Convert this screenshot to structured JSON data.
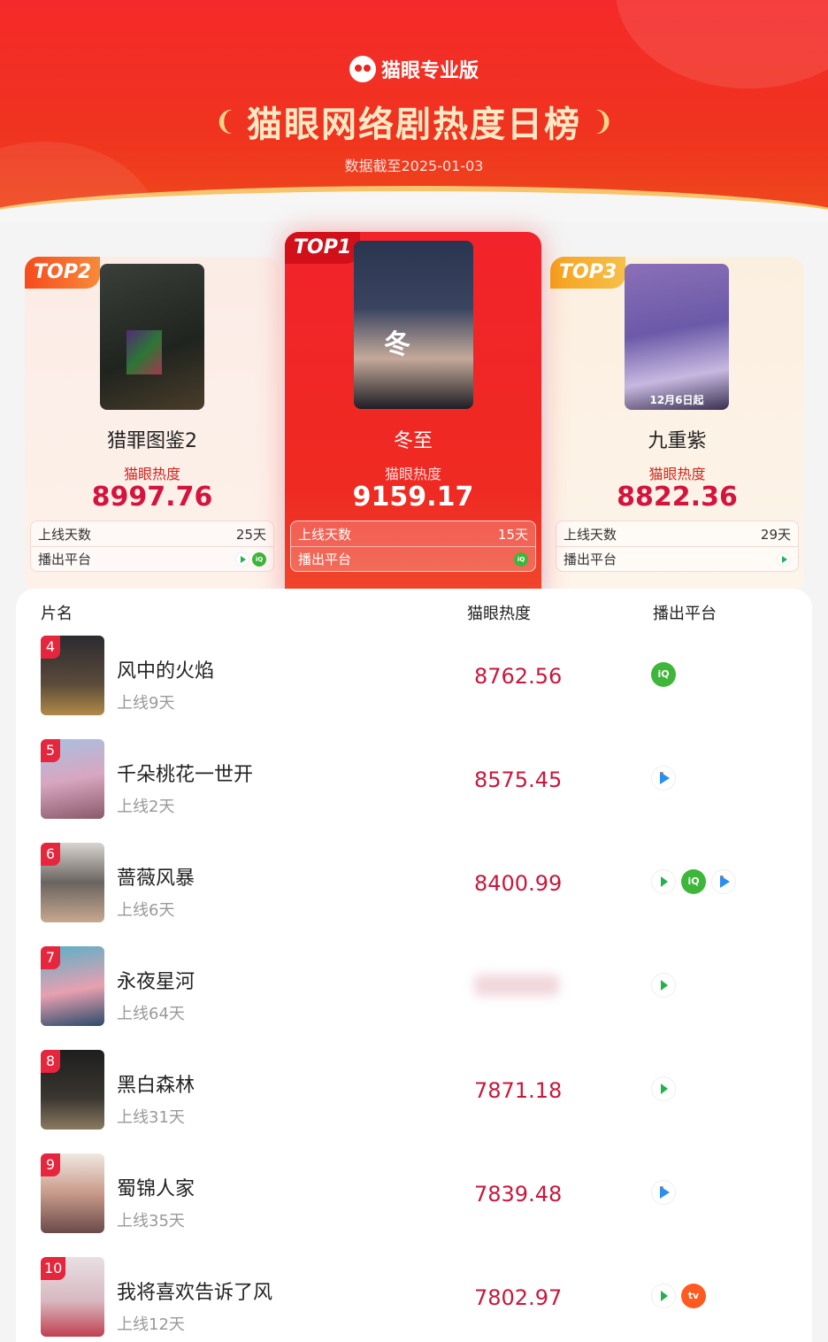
{
  "header": {
    "brand": "猫眼专业版",
    "title": "猫眼网络剧热度日榜",
    "subtitle": "数据截至2025-01-03"
  },
  "top3": [
    {
      "rank_label": "TOP2",
      "name": "猎罪图鉴2",
      "heat_label": "猫眼热度",
      "heat": "8997.76",
      "days_label": "上线天数",
      "days": "25天",
      "platform_label": "播出平台",
      "platforms": [
        "tencent",
        "iqiyi"
      ]
    },
    {
      "rank_label": "TOP1",
      "name": "冬至",
      "heat_label": "猫眼热度",
      "heat": "9159.17",
      "days_label": "上线天数",
      "days": "15天",
      "platform_label": "播出平台",
      "platforms": [
        "iqiyi"
      ]
    },
    {
      "rank_label": "TOP3",
      "name": "九重紫",
      "heat_label": "猫眼热度",
      "heat": "8822.36",
      "days_label": "上线天数",
      "days": "29天",
      "platform_label": "播出平台",
      "platforms": [
        "tencent"
      ]
    }
  ],
  "table": {
    "headers": {
      "name": "片名",
      "heat": "猫眼热度",
      "platform": "播出平台"
    },
    "rows": [
      {
        "rank": "4",
        "name": "风中的火焰",
        "days": "上线9天",
        "heat": "8762.56",
        "platforms": [
          "iqiyi"
        ]
      },
      {
        "rank": "5",
        "name": "千朵桃花一世开",
        "days": "上线2天",
        "heat": "8575.45",
        "platforms": [
          "youku"
        ]
      },
      {
        "rank": "6",
        "name": "蔷薇风暴",
        "days": "上线6天",
        "heat": "8400.99",
        "platforms": [
          "tencent",
          "iqiyi",
          "youku"
        ]
      },
      {
        "rank": "7",
        "name": "永夜星河",
        "days": "上线64天",
        "heat": "",
        "platforms": [
          "tencent"
        ]
      },
      {
        "rank": "8",
        "name": "黑白森林",
        "days": "上线31天",
        "heat": "7871.18",
        "platforms": [
          "tencent"
        ]
      },
      {
        "rank": "9",
        "name": "蜀锦人家",
        "days": "上线35天",
        "heat": "7839.48",
        "platforms": [
          "youku"
        ]
      },
      {
        "rank": "10",
        "name": "我将喜欢告诉了风",
        "days": "上线12天",
        "heat": "7802.97",
        "platforms": [
          "tencent",
          "mango"
        ]
      }
    ]
  },
  "colors": {
    "brand_red": "#f42a2a",
    "heat_red": "#c8183c",
    "gold": "#f7c36b"
  },
  "icons": {
    "brand": "cat-eye-logo-icon",
    "laurel": "laurel-icon"
  }
}
